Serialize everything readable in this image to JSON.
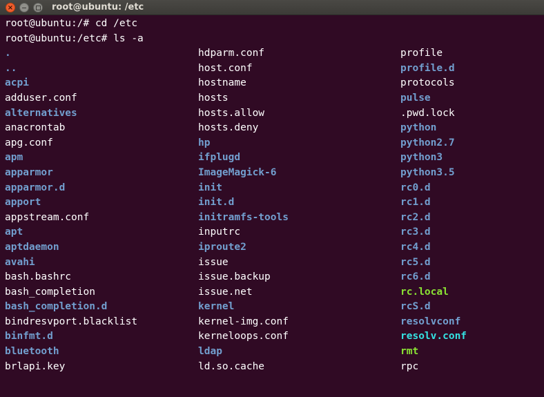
{
  "window": {
    "title": "root@ubuntu: /etc",
    "close_glyph": "×"
  },
  "colors": {
    "background": "#300a24",
    "file": "#ffffff",
    "directory": "#729fcf",
    "executable": "#8ae234",
    "symlink": "#34e2e2"
  },
  "terminal": {
    "commands": [
      "root@ubuntu:/# cd /etc",
      "root@ubuntu:/etc# ls -a"
    ],
    "listing": [
      [
        {
          "name": ".",
          "type": "dir"
        },
        {
          "name": "hdparm.conf",
          "type": "file"
        },
        {
          "name": "profile",
          "type": "file"
        }
      ],
      [
        {
          "name": "..",
          "type": "dir"
        },
        {
          "name": "host.conf",
          "type": "file"
        },
        {
          "name": "profile.d",
          "type": "dir"
        }
      ],
      [
        {
          "name": "acpi",
          "type": "dir"
        },
        {
          "name": "hostname",
          "type": "file"
        },
        {
          "name": "protocols",
          "type": "file"
        }
      ],
      [
        {
          "name": "adduser.conf",
          "type": "file"
        },
        {
          "name": "hosts",
          "type": "file"
        },
        {
          "name": "pulse",
          "type": "dir"
        }
      ],
      [
        {
          "name": "alternatives",
          "type": "dir"
        },
        {
          "name": "hosts.allow",
          "type": "file"
        },
        {
          "name": ".pwd.lock",
          "type": "file"
        }
      ],
      [
        {
          "name": "anacrontab",
          "type": "file"
        },
        {
          "name": "hosts.deny",
          "type": "file"
        },
        {
          "name": "python",
          "type": "dir"
        }
      ],
      [
        {
          "name": "apg.conf",
          "type": "file"
        },
        {
          "name": "hp",
          "type": "dir"
        },
        {
          "name": "python2.7",
          "type": "dir"
        }
      ],
      [
        {
          "name": "apm",
          "type": "dir"
        },
        {
          "name": "ifplugd",
          "type": "dir"
        },
        {
          "name": "python3",
          "type": "dir"
        }
      ],
      [
        {
          "name": "apparmor",
          "type": "dir"
        },
        {
          "name": "ImageMagick-6",
          "type": "dir"
        },
        {
          "name": "python3.5",
          "type": "dir"
        }
      ],
      [
        {
          "name": "apparmor.d",
          "type": "dir"
        },
        {
          "name": "init",
          "type": "dir"
        },
        {
          "name": "rc0.d",
          "type": "dir"
        }
      ],
      [
        {
          "name": "apport",
          "type": "dir"
        },
        {
          "name": "init.d",
          "type": "dir"
        },
        {
          "name": "rc1.d",
          "type": "dir"
        }
      ],
      [
        {
          "name": "appstream.conf",
          "type": "file"
        },
        {
          "name": "initramfs-tools",
          "type": "dir"
        },
        {
          "name": "rc2.d",
          "type": "dir"
        }
      ],
      [
        {
          "name": "apt",
          "type": "dir"
        },
        {
          "name": "inputrc",
          "type": "file"
        },
        {
          "name": "rc3.d",
          "type": "dir"
        }
      ],
      [
        {
          "name": "aptdaemon",
          "type": "dir"
        },
        {
          "name": "iproute2",
          "type": "dir"
        },
        {
          "name": "rc4.d",
          "type": "dir"
        }
      ],
      [
        {
          "name": "avahi",
          "type": "dir"
        },
        {
          "name": "issue",
          "type": "file"
        },
        {
          "name": "rc5.d",
          "type": "dir"
        }
      ],
      [
        {
          "name": "bash.bashrc",
          "type": "file"
        },
        {
          "name": "issue.backup",
          "type": "file"
        },
        {
          "name": "rc6.d",
          "type": "dir"
        }
      ],
      [
        {
          "name": "bash_completion",
          "type": "file"
        },
        {
          "name": "issue.net",
          "type": "file"
        },
        {
          "name": "rc.local",
          "type": "exec"
        }
      ],
      [
        {
          "name": "bash_completion.d",
          "type": "dir"
        },
        {
          "name": "kernel",
          "type": "dir"
        },
        {
          "name": "rcS.d",
          "type": "dir"
        }
      ],
      [
        {
          "name": "bindresvport.blacklist",
          "type": "file"
        },
        {
          "name": "kernel-img.conf",
          "type": "file"
        },
        {
          "name": "resolvconf",
          "type": "dir"
        }
      ],
      [
        {
          "name": "binfmt.d",
          "type": "dir"
        },
        {
          "name": "kerneloops.conf",
          "type": "file"
        },
        {
          "name": "resolv.conf",
          "type": "link"
        }
      ],
      [
        {
          "name": "bluetooth",
          "type": "dir"
        },
        {
          "name": "ldap",
          "type": "dir"
        },
        {
          "name": "rmt",
          "type": "exec"
        }
      ],
      [
        {
          "name": "brlapi.key",
          "type": "file"
        },
        {
          "name": "ld.so.cache",
          "type": "file"
        },
        {
          "name": "rpc",
          "type": "file"
        }
      ]
    ]
  }
}
